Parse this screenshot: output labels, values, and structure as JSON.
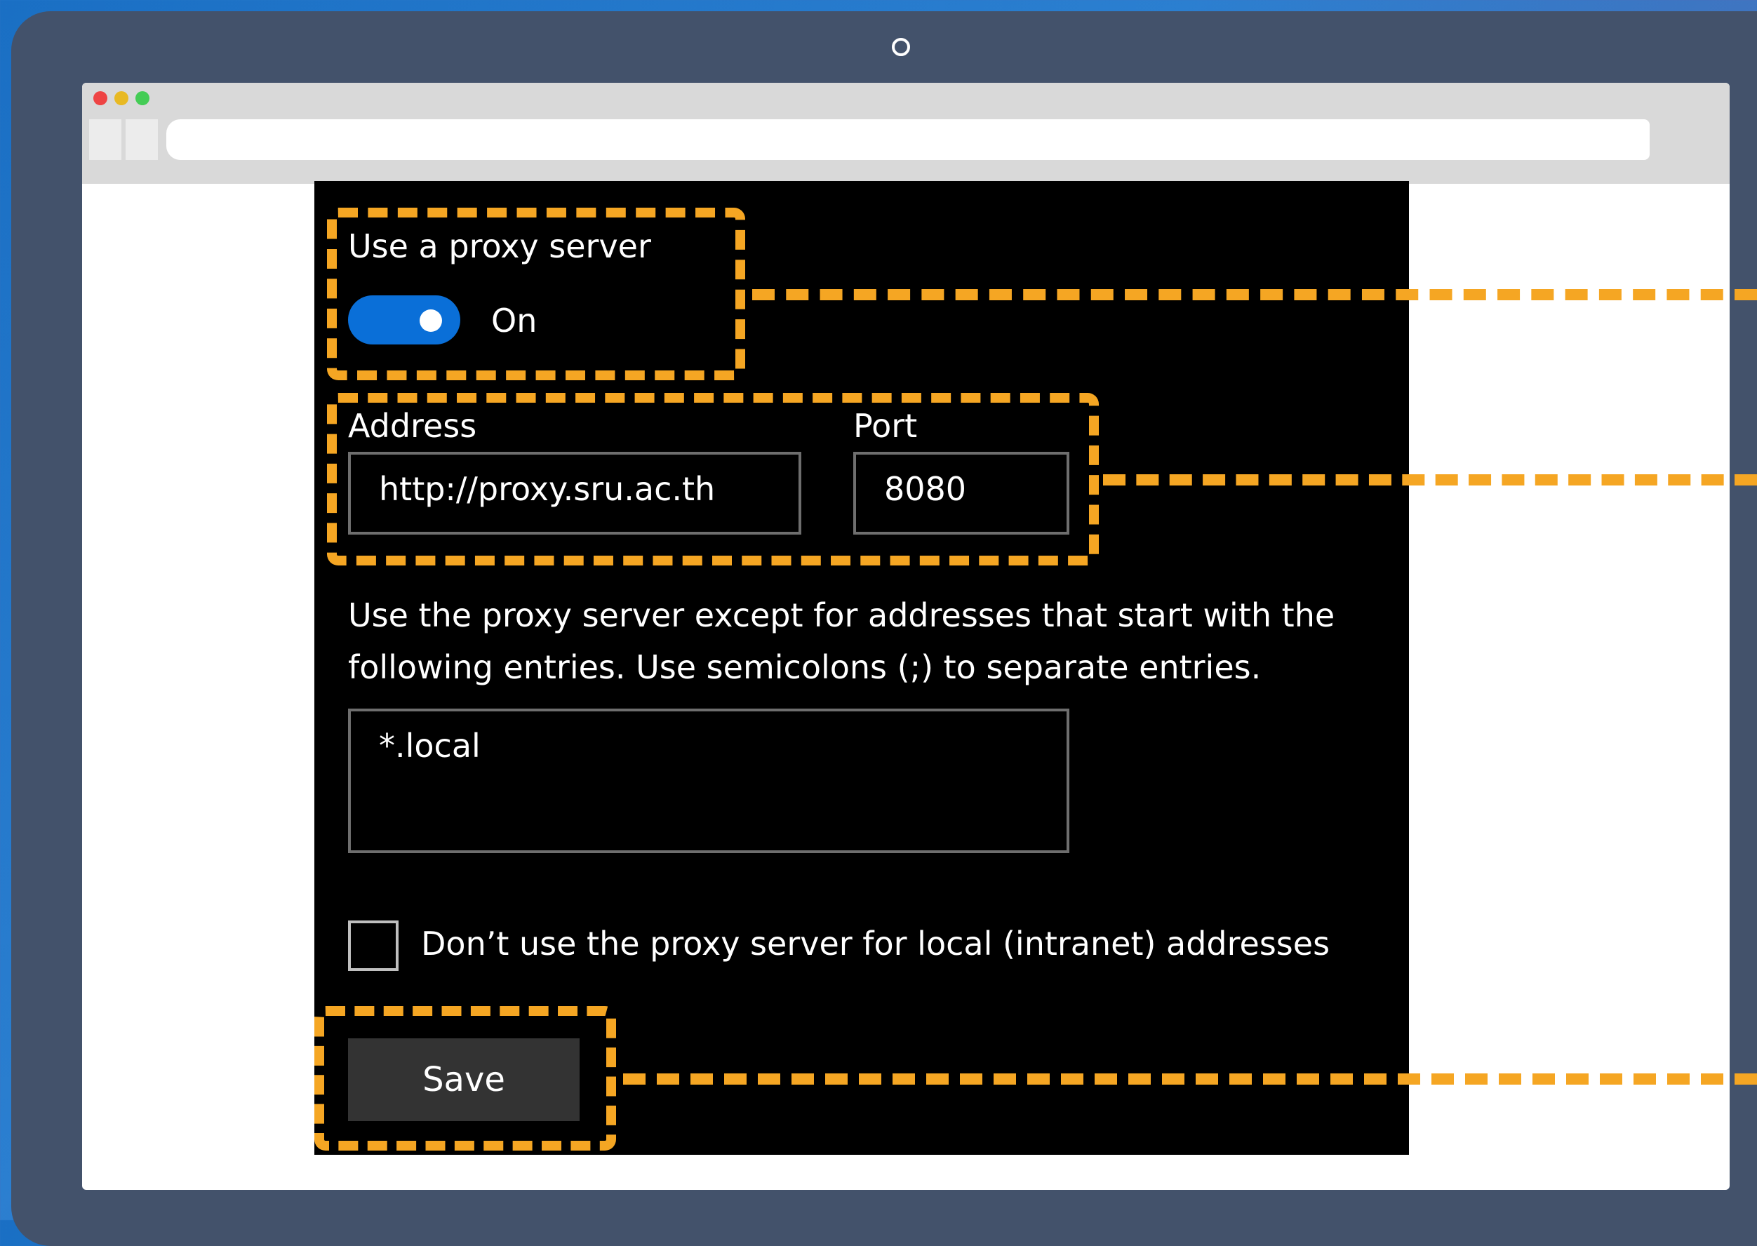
{
  "proxy": {
    "heading": "Use a proxy server",
    "toggle_state": "On",
    "toggle_on": true
  },
  "address": {
    "label": "Address",
    "value": "http://proxy.sru.ac.th"
  },
  "port": {
    "label": "Port",
    "value": "8080"
  },
  "exceptions": {
    "description": "Use the proxy server except for addresses that start with the following entries. Use semicolons (;) to separate entries.",
    "value": "*.local"
  },
  "local_bypass": {
    "label": "Don’t use the proxy server for local (intranet) addresses",
    "checked": false
  },
  "save": {
    "label": "Save"
  },
  "colors": {
    "toggle_accent": "#0a6fd8",
    "callout": "#f5a623",
    "panel_background": "#000000"
  }
}
